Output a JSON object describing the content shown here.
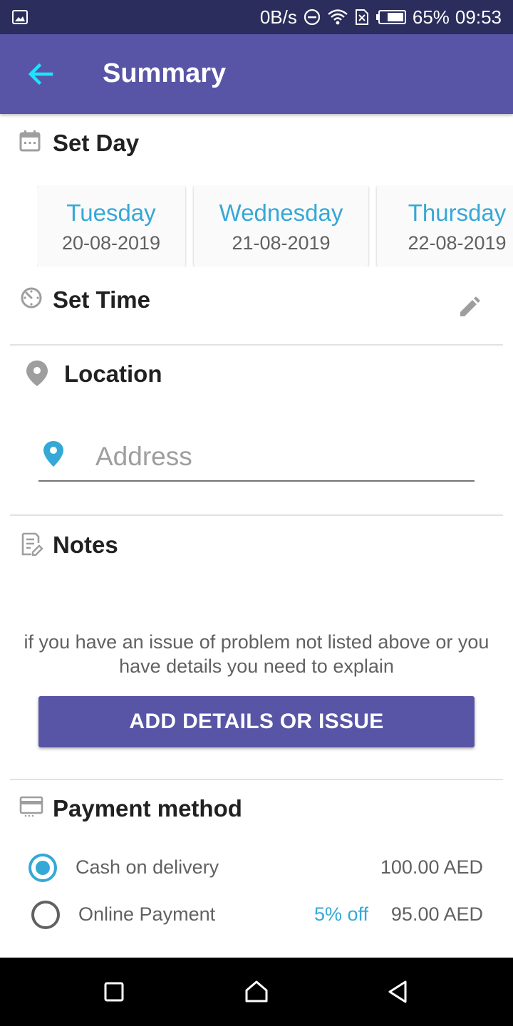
{
  "status_bar": {
    "net_speed": "0B/s",
    "battery": "65%",
    "time": "09:53",
    "icons": [
      "image-icon",
      "dnd-icon",
      "wifi-icon",
      "sim-x-icon",
      "battery-icon"
    ]
  },
  "app_bar": {
    "title": "Summary",
    "back_icon": "arrow-left-icon"
  },
  "set_day": {
    "title": "Set Day",
    "icon": "calendar-icon",
    "days": [
      {
        "day": "Tuesday",
        "date": "20-08-2019"
      },
      {
        "day": "Wednesday",
        "date": "21-08-2019"
      },
      {
        "day": "Thursday",
        "date": "22-08-2019"
      }
    ]
  },
  "set_time": {
    "title": "Set Time",
    "icon": "timer-icon",
    "edit_icon": "pencil-icon"
  },
  "location": {
    "title": "Location",
    "icon": "location-pin-icon",
    "address_placeholder": "Address",
    "address_value": ""
  },
  "notes": {
    "title": "Notes",
    "icon": "notes-edit-icon",
    "hint": "if you have an issue of problem not listed above or you have details you need to explain",
    "button_label": "ADD DETAILS OR ISSUE"
  },
  "payment": {
    "title": "Payment method",
    "icon": "credit-card-icon",
    "options": [
      {
        "label": "Cash on delivery",
        "discount": "",
        "amount": "100.00 AED",
        "selected": true
      },
      {
        "label": "Online Payment",
        "discount": "5% off",
        "amount": "95.00 AED",
        "selected": false
      }
    ]
  },
  "colors": {
    "status_bar": "#2b2e5c",
    "primary": "#5855a6",
    "accent": "#35a8d6",
    "back_arrow": "#1ee3ff"
  },
  "nav_bar": {
    "icons": [
      "recent-apps-icon",
      "home-icon",
      "back-triangle-icon"
    ]
  }
}
